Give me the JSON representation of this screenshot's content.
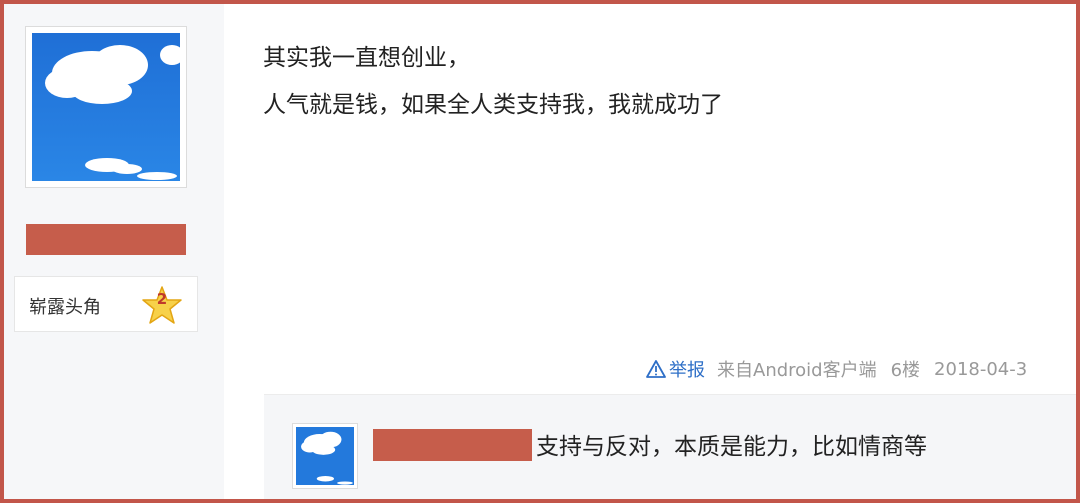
{
  "user": {
    "avatar_icon": "sky-cloud-avatar-icon",
    "level_name": "崭露头角",
    "level_number": "2",
    "star_icon": "star-icon",
    "redaction_color": "#c65d4b"
  },
  "post": {
    "lines": [
      "其实我一直想创业，",
      "人气就是钱，如果全人类支持我，我就成功了"
    ]
  },
  "meta": {
    "report_icon": "warning-triangle-icon",
    "report_label": "举报",
    "client": "来自Android客户端",
    "floor": "6楼",
    "date": "2018-04-3"
  },
  "reply": {
    "avatar_icon": "sky-cloud-avatar-icon",
    "text": "支持与反对，本质是能力，比如情商等"
  },
  "colors": {
    "border": "#c2564a",
    "link": "#2e6fc7",
    "meta_text": "#999999"
  }
}
